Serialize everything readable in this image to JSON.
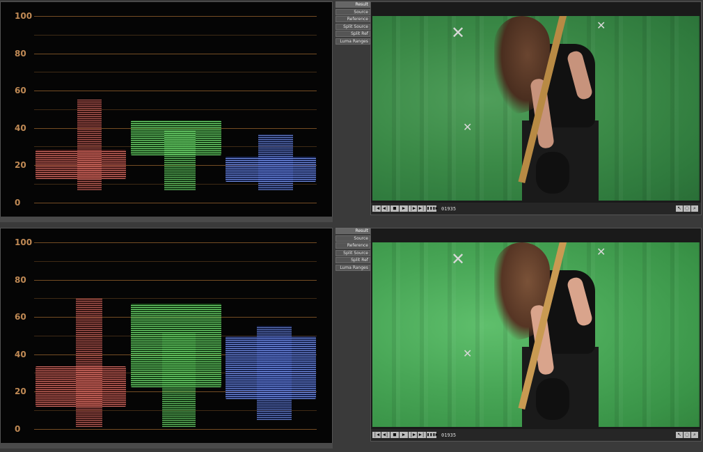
{
  "top": {
    "scope_ticks": [
      "100",
      "80",
      "60",
      "40",
      "20",
      "0"
    ],
    "view_buttons": [
      "Result",
      "Source",
      "Reference",
      "Split Source",
      "Split Ref",
      "Luma Ranges"
    ],
    "frame_number": "01935"
  },
  "bottom": {
    "scope_ticks": [
      "100",
      "80",
      "60",
      "40",
      "20",
      "0"
    ],
    "view_buttons": [
      "Result",
      "Source",
      "Reference",
      "Split Source",
      "Split Ref",
      "Luma Ranges"
    ],
    "frame_number": "01935"
  },
  "transport": {
    "buttons": [
      "|◀",
      "◀|",
      "■",
      "▶",
      "|▶",
      "▶|",
      "▮▮▮▶"
    ],
    "tools": [
      "↖",
      "◌",
      "⌕"
    ]
  },
  "icons": [
    "go-to-start-icon",
    "step-back-icon",
    "stop-icon",
    "play-icon",
    "step-forward-icon",
    "go-to-end-icon",
    "loop-icon",
    "pointer-icon",
    "hand-icon",
    "zoom-icon"
  ],
  "colors": {
    "scope_grid": "#8a5a2a",
    "red_channel": "#e8786e",
    "green_channel": "#78e678",
    "blue_channel": "#7896f0",
    "green_screen": "#3b8a47"
  }
}
